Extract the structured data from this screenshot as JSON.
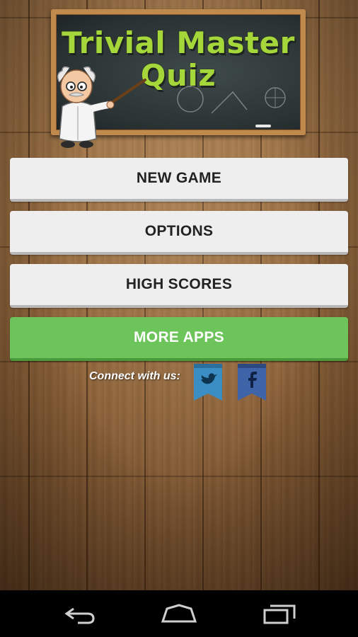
{
  "app": {
    "title_line1": "Trivial Master",
    "title_line2": "Quiz"
  },
  "menu": {
    "new_game": "NEW GAME",
    "options": "OPTIONS",
    "high_scores": "HIGH SCORES",
    "more_apps": "MORE APPS"
  },
  "social": {
    "connect_label": "Connect with us:",
    "twitter_icon": "twitter-icon",
    "facebook_icon": "facebook-icon"
  },
  "navigation": {
    "back": "back-icon",
    "home": "home-icon",
    "recents": "recents-icon"
  },
  "colors": {
    "title_chalk": "#a5d63a",
    "more_apps_button": "#6cc45a",
    "menu_button": "#eeeeee",
    "ribbon": "#3a8ec4"
  }
}
